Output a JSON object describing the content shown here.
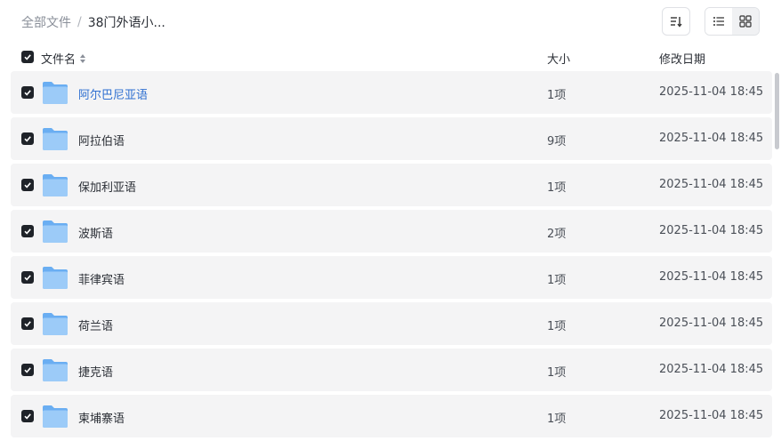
{
  "breadcrumb": {
    "root": "全部文件",
    "separator": "/",
    "current": "38门外语小..."
  },
  "toolbar": {
    "sort_icon": "sort-icon",
    "list_view_icon": "list-view-icon",
    "grid_view_icon": "grid-view-icon"
  },
  "table": {
    "headers": {
      "name": "文件名",
      "size": "大小",
      "modified": "修改日期"
    },
    "rows": [
      {
        "name": "阿尔巴尼亚语",
        "size": "1项",
        "modified": "2025-11-04 18:45"
      },
      {
        "name": "阿拉伯语",
        "size": "9项",
        "modified": "2025-11-04 18:45"
      },
      {
        "name": "保加利亚语",
        "size": "1项",
        "modified": "2025-11-04 18:45"
      },
      {
        "name": "波斯语",
        "size": "2项",
        "modified": "2025-11-04 18:45"
      },
      {
        "name": "菲律宾语",
        "size": "1项",
        "modified": "2025-11-04 18:45"
      },
      {
        "name": "荷兰语",
        "size": "1项",
        "modified": "2025-11-04 18:45"
      },
      {
        "name": "捷克语",
        "size": "1项",
        "modified": "2025-11-04 18:45"
      },
      {
        "name": "柬埔寨语",
        "size": "1项",
        "modified": "2025-11-04 18:45"
      }
    ]
  },
  "colors": {
    "link": "#2e6fd1",
    "row_bg": "#f4f4f5",
    "checkbox": "#1f2329",
    "folder": "#7ab8f5"
  }
}
